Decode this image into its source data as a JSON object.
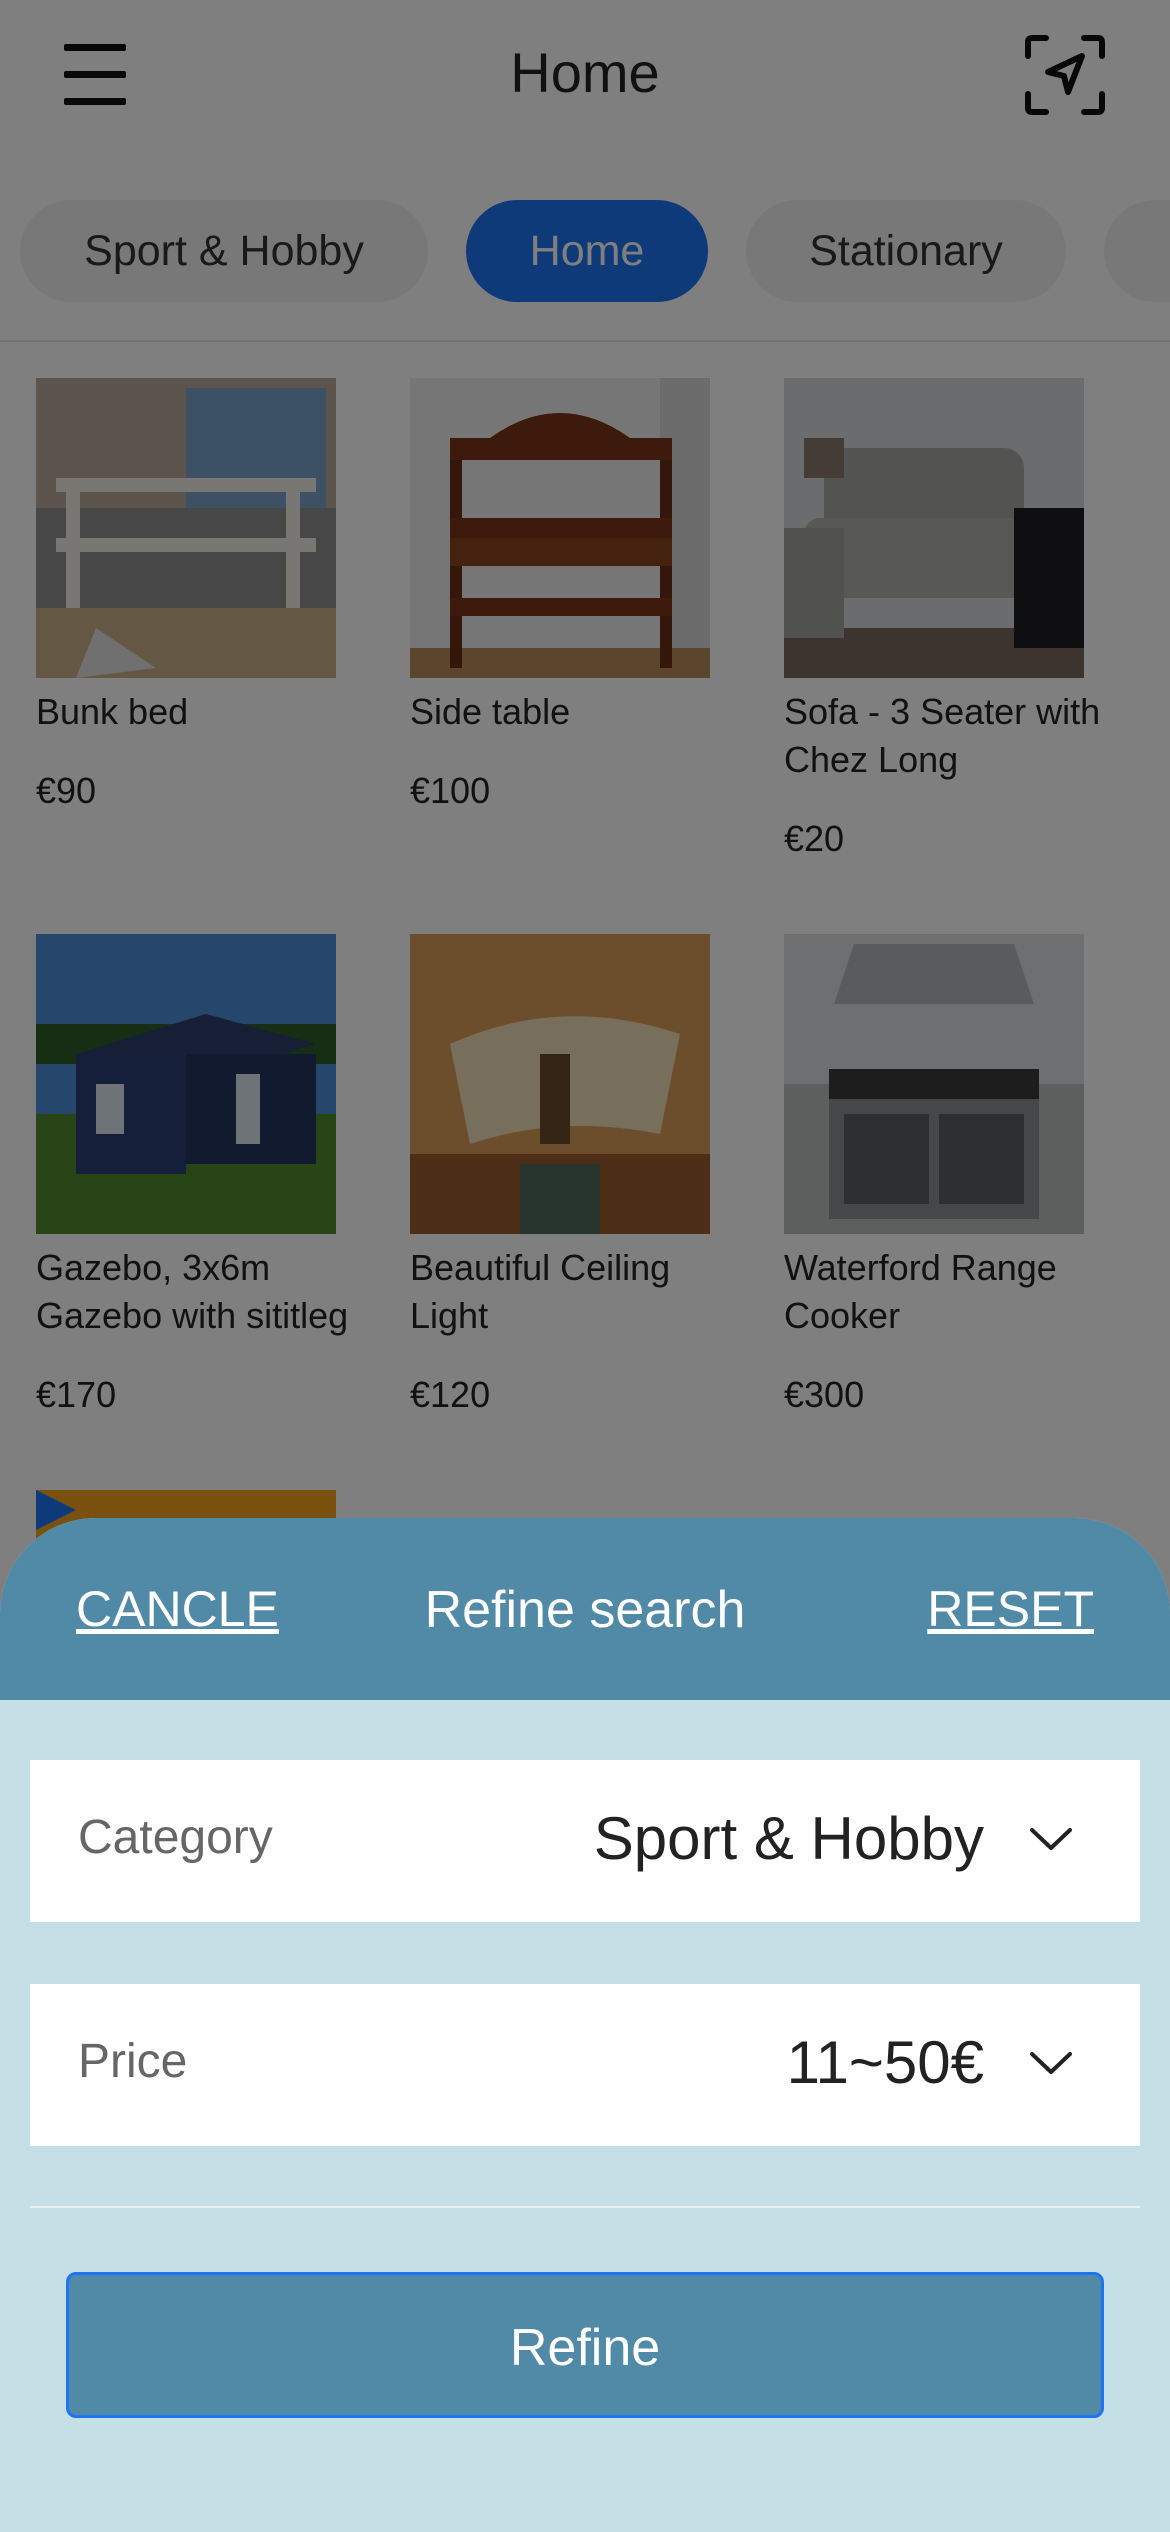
{
  "header": {
    "title": "Home"
  },
  "tabs": [
    {
      "label": "Sport & Hobby",
      "active": false
    },
    {
      "label": "Home",
      "active": true
    },
    {
      "label": "Stationary",
      "active": false
    },
    {
      "label": "",
      "active": false
    }
  ],
  "products": [
    {
      "title": "Bunk bed",
      "price": "€90"
    },
    {
      "title": "Side table",
      "price": "€100"
    },
    {
      "title": "Sofa - 3 Seater with Chez Long",
      "price": "€20"
    },
    {
      "title": "Gazebo, 3x6m Gazebo with sititleg",
      "price": "€170"
    },
    {
      "title": "Beautiful Ceiling Light",
      "price": "€120"
    },
    {
      "title": "Waterford Range Cooker",
      "price": "€300"
    }
  ],
  "sheet": {
    "cancel_label": "CANCLE",
    "title": "Refine search",
    "reset_label": "RESET",
    "category": {
      "label": "Category",
      "value": "Sport & Hobby"
    },
    "price": {
      "label": "Price",
      "value": "11~50€"
    },
    "refine_label": "Refine"
  },
  "colors": {
    "accent": "#1d74f5",
    "sheet_header": "#518aa6",
    "sheet_bg": "#c4dfe6"
  }
}
